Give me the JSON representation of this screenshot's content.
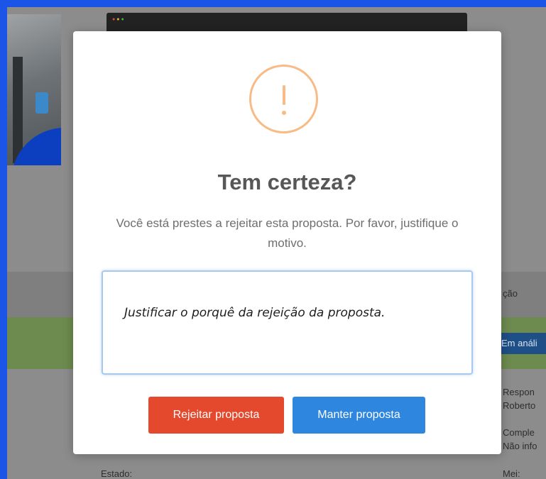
{
  "background": {
    "column_header": "ção",
    "status_badge": "Em análi",
    "details": [
      {
        "label": "Respon",
        "value": "Roberto"
      },
      {
        "label": "Comple",
        "value": "Não info"
      }
    ],
    "footer_left": "Estado:",
    "footer_right": "Mei:"
  },
  "dialog": {
    "icon": "exclamation-circle-icon",
    "title": "Tem certeza?",
    "message": "Você está prestes a rejeitar esta proposta. Por favor, justifique o motivo.",
    "reason_placeholder": "Justificar o porquê da rejeição da proposta.",
    "reject_label": "Rejeitar proposta",
    "keep_label": "Manter proposta"
  },
  "colors": {
    "warning": "#f8bb86",
    "reject": "#e4492d",
    "keep": "#2e86de",
    "frame": "#1a55e8"
  }
}
